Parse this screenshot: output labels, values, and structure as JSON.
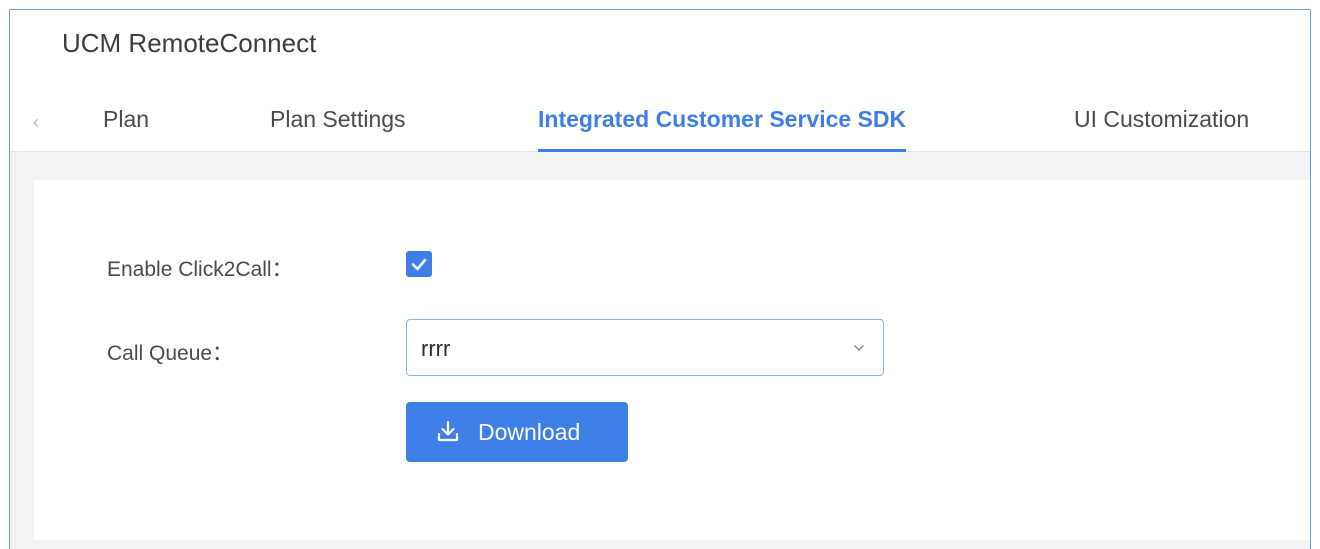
{
  "app": {
    "title": "UCM RemoteConnect"
  },
  "tabs": {
    "prev_icon": "chevron-left-icon",
    "items": [
      {
        "label": "Plan",
        "active": false
      },
      {
        "label": "Plan Settings",
        "active": false
      },
      {
        "label": "Integrated Customer Service SDK",
        "active": true
      },
      {
        "label": "UI Customization",
        "active": false
      }
    ]
  },
  "form": {
    "click2call": {
      "label": "Enable Click2Call：",
      "checked": true
    },
    "call_queue": {
      "label": "Call Queue：",
      "value": "rrrr",
      "arrow_icon": "chevron-down-icon"
    },
    "download": {
      "label": "Download",
      "icon": "download-icon"
    }
  },
  "colors": {
    "accent": "#3d7fe6",
    "frame_border": "#6d9bd6",
    "content_background": "#f2f3f5"
  }
}
